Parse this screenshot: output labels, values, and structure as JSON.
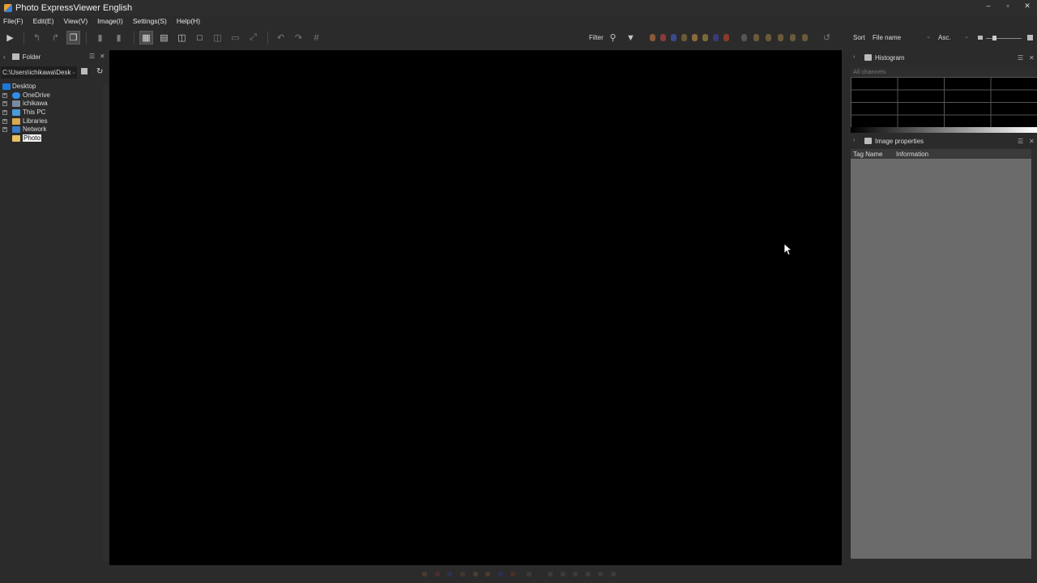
{
  "window": {
    "title": "Photo ExpressViewer English",
    "controls": [
      "–",
      "▫",
      "✕"
    ]
  },
  "menu": [
    "File(F)",
    "Edit(E)",
    "View(V)",
    "Image(I)",
    "Settings(S)",
    "Help(H)"
  ],
  "toolbar": {
    "filter_label": "Filter",
    "sort_label": "Sort",
    "sort_value": "File name",
    "order_value": "Asc."
  },
  "folder_panel": {
    "title": "Folder",
    "path": "C:\\Users\\ichikawa\\Desk",
    "tree": {
      "root": "Desktop",
      "items": [
        "OneDrive",
        "ichikawa",
        "This PC",
        "Libraries",
        "Network"
      ],
      "selected": "Photo"
    }
  },
  "histogram_panel": {
    "title": "Histogram",
    "channel": "All channels"
  },
  "properties_panel": {
    "title": "Image properties",
    "columns": [
      "Tag Name",
      "Information"
    ]
  },
  "icons": {
    "left_tree": [
      "onedrive-cloud-icon",
      "user-icon",
      "pc-icon",
      "libraries-icon",
      "network-icon",
      "folder-icon"
    ],
    "colors": {
      "cloud": "#2f8fe8",
      "folder": "#e8c060",
      "desktop": "#1e78d6",
      "accent_orange": "#b8734a"
    }
  }
}
